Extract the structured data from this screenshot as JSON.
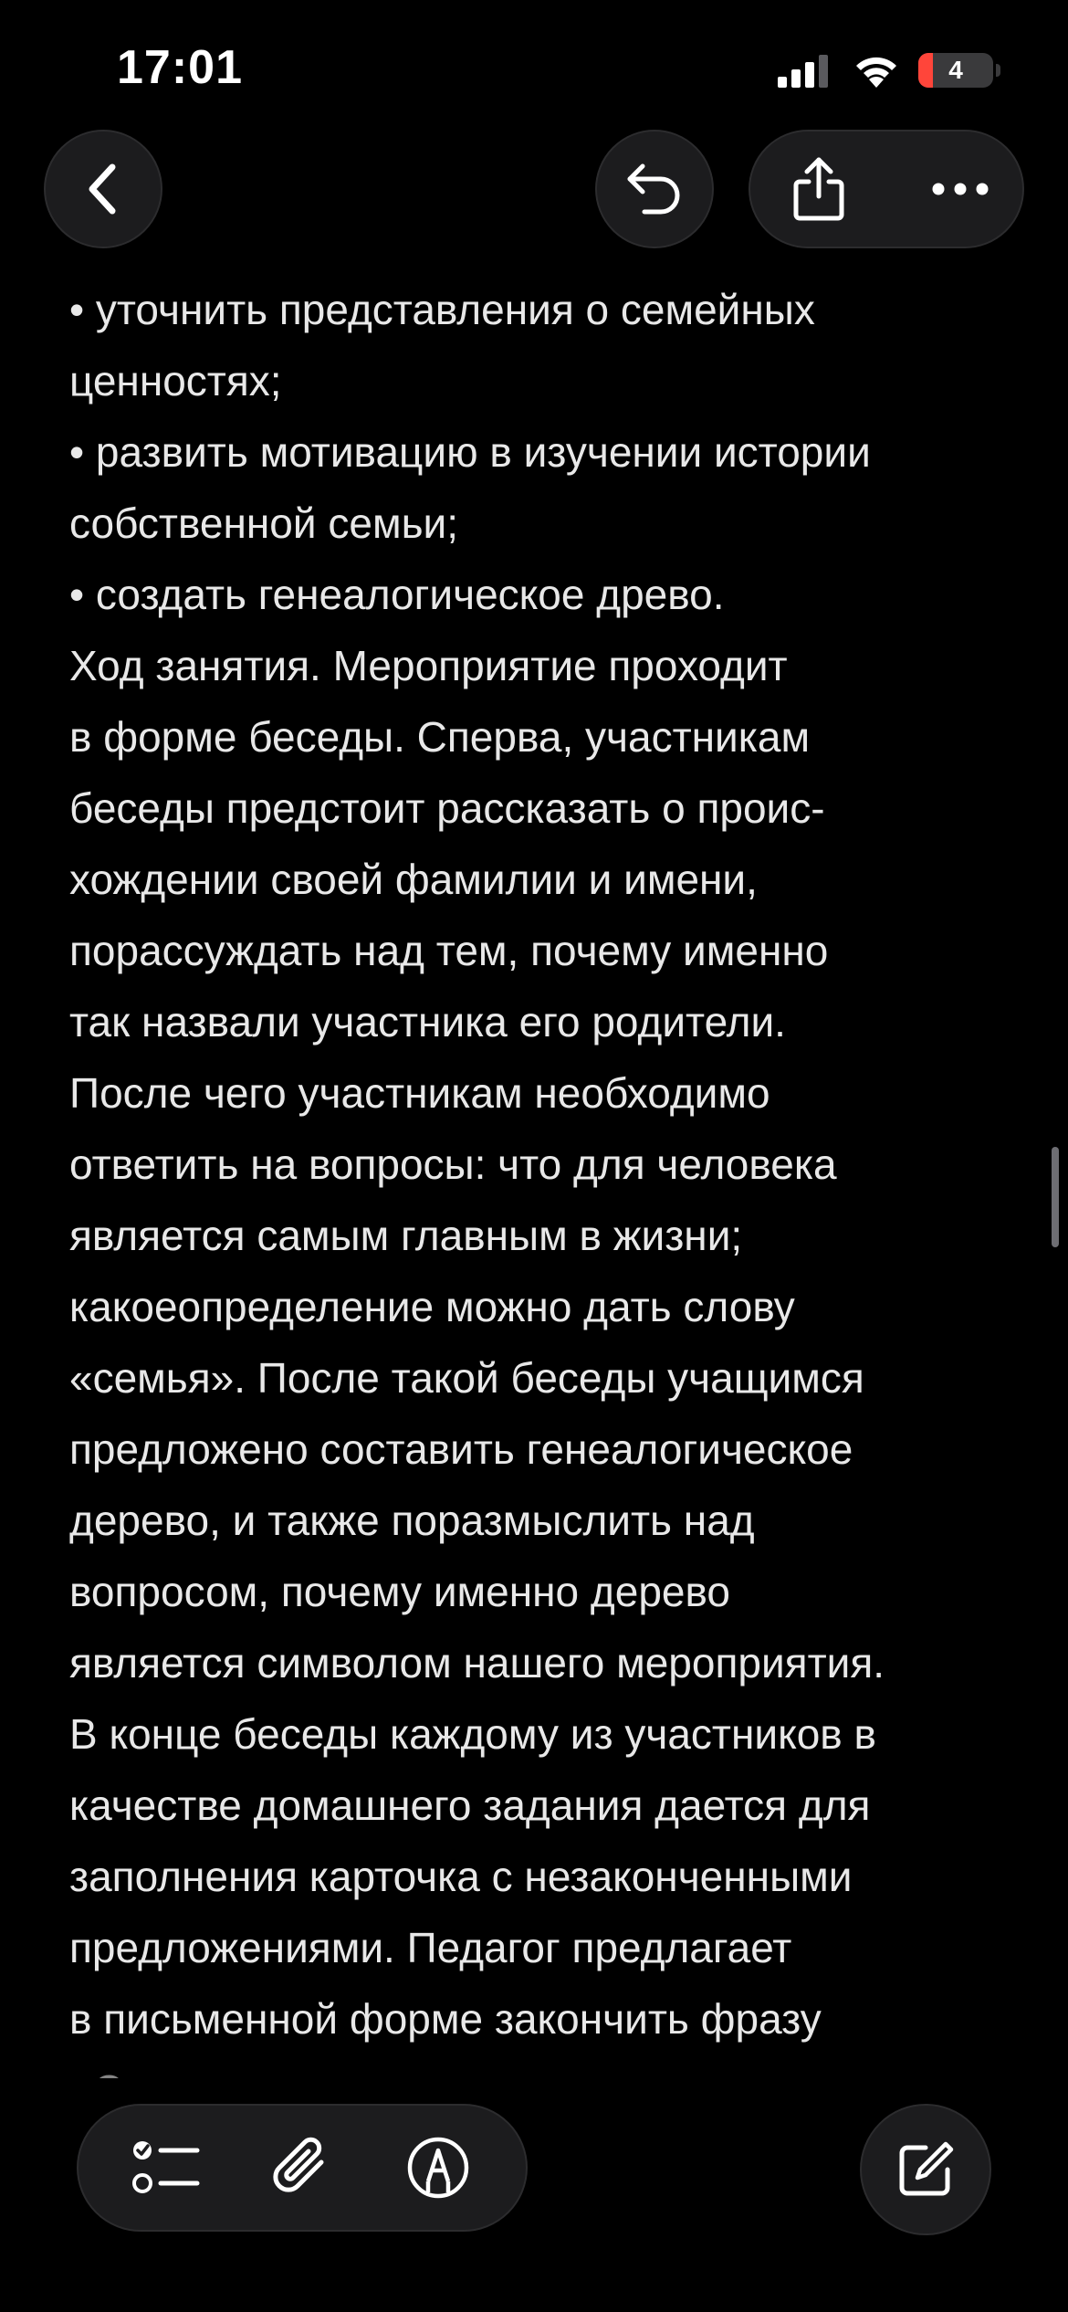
{
  "status_bar": {
    "time": "17:01",
    "battery_percent": "4",
    "icons": [
      "cellular-signal-icon",
      "wifi-icon",
      "battery-icon"
    ]
  },
  "navigation": {
    "back_icon": "chevron-left-icon",
    "undo_icon": "undo-arrow-icon",
    "share_icon": "share-icon",
    "more_icon": "ellipsis-icon"
  },
  "note": {
    "lines": [
      "• уточнить представления о семейных",
      "ценностях;",
      "• развить мотивацию в изучении истории",
      "собственной семьи;",
      "• создать генеалогическое древо.",
      "Ход занятия. Мероприятие проходит",
      "в форме беседы. Сперва, участникам",
      "беседы предстоит рассказать о проис-",
      "хождении своей фамилии и имени,",
      "порассуждать над тем, почему именно",
      "так назвали участника его родители.",
      "После чего участникам необходимо",
      "ответить на вопросы: что для человека",
      "является самым главным в жизни;",
      "какоеопределение можно дать слову",
      "«семья». После такой беседы учащимся",
      "предложено составить генеалогическое",
      "дерево, и также поразмыслить над",
      "вопросом, почему именно дерево",
      "является символом нашего мероприятия.",
      "В конце беседы каждому из участников в",
      "качестве домашнего задания дается для",
      "заполнения карточка с незаконченными",
      "предложениями. Педагог предлагает",
      "в письменной форме закончить фразу",
      "«Семья для меня – это…»."
    ]
  },
  "toolbar": {
    "checklist_icon": "checklist-icon",
    "attachment_icon": "paperclip-icon",
    "markup_icon": "markup-pen-icon",
    "compose_icon": "compose-icon"
  },
  "colors": {
    "background": "#000000",
    "text": "#e8e8e8",
    "button_bg": "#1c1c1e",
    "battery_low": "#ff453a"
  }
}
